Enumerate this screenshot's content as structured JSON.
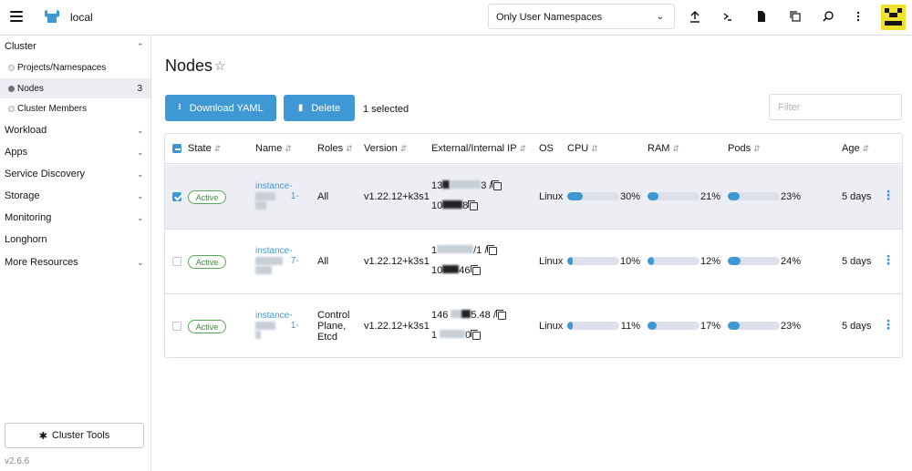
{
  "header": {
    "cluster_name": "local",
    "namespace_filter": "Only User Namespaces",
    "icons": [
      "upload-icon",
      "shell-icon",
      "file-icon",
      "copy-config-icon",
      "search-icon",
      "more-vertical-icon"
    ]
  },
  "sidebar": {
    "groups": [
      {
        "label": "Cluster",
        "expanded": true
      },
      {
        "label": "Workload"
      },
      {
        "label": "Apps"
      },
      {
        "label": "Service Discovery"
      },
      {
        "label": "Storage"
      },
      {
        "label": "Monitoring"
      },
      {
        "label": "Longhorn"
      },
      {
        "label": "More Resources"
      }
    ],
    "cluster_items": [
      {
        "label": "Projects/Namespaces"
      },
      {
        "label": "Nodes",
        "count": "3",
        "active": true
      },
      {
        "label": "Cluster Members"
      }
    ],
    "tools_label": "Cluster Tools",
    "version": "v2.6.6"
  },
  "main": {
    "title": "Nodes",
    "download_label": "Download YAML",
    "delete_label": "Delete",
    "selected_text": "1 selected",
    "filter_placeholder": "Filter"
  },
  "table": {
    "columns": [
      "State",
      "Name",
      "Roles",
      "Version",
      "External/Internal IP",
      "OS",
      "CPU",
      "RAM",
      "Pods",
      "Age"
    ],
    "rows": [
      {
        "selected": true,
        "state": "Active",
        "name_a": "instance-",
        "name_b": "1-",
        "roles": "All",
        "version": "v1.22.12+k3s1",
        "ip1_a": "13",
        "ip1_b": "3 /",
        "ip2_a": "10",
        "ip2_b": "8",
        "os": "Linux",
        "cpu": 30,
        "ram": 21,
        "pods": 23,
        "cpu_label": "30%",
        "ram_label": "21%",
        "pods_label": "23%",
        "age": "5 days"
      },
      {
        "selected": false,
        "state": "Active",
        "name_a": "instance-",
        "name_b": "7-",
        "roles": "All",
        "version": "v1.22.12+k3s1",
        "ip1_a": "1",
        "ip1_b": "/1 /",
        "ip2_a": "10",
        "ip2_b": "46",
        "os": "Linux",
        "cpu": 10,
        "ram": 12,
        "pods": 24,
        "cpu_label": "10%",
        "ram_label": "12%",
        "pods_label": "24%",
        "age": "5 days"
      },
      {
        "selected": false,
        "state": "Active",
        "name_a": "instance-",
        "name_b": "1-",
        "roles": "Control Plane, Etcd",
        "version": "v1.22.12+k3s1",
        "ip1_a": "146",
        "ip1_b": "5.48 /",
        "ip2_a": "1",
        "ip2_b": "0",
        "os": "Linux",
        "cpu": 11,
        "ram": 17,
        "pods": 23,
        "cpu_label": "11%",
        "ram_label": "17%",
        "pods_label": "23%",
        "age": "5 days"
      }
    ]
  }
}
